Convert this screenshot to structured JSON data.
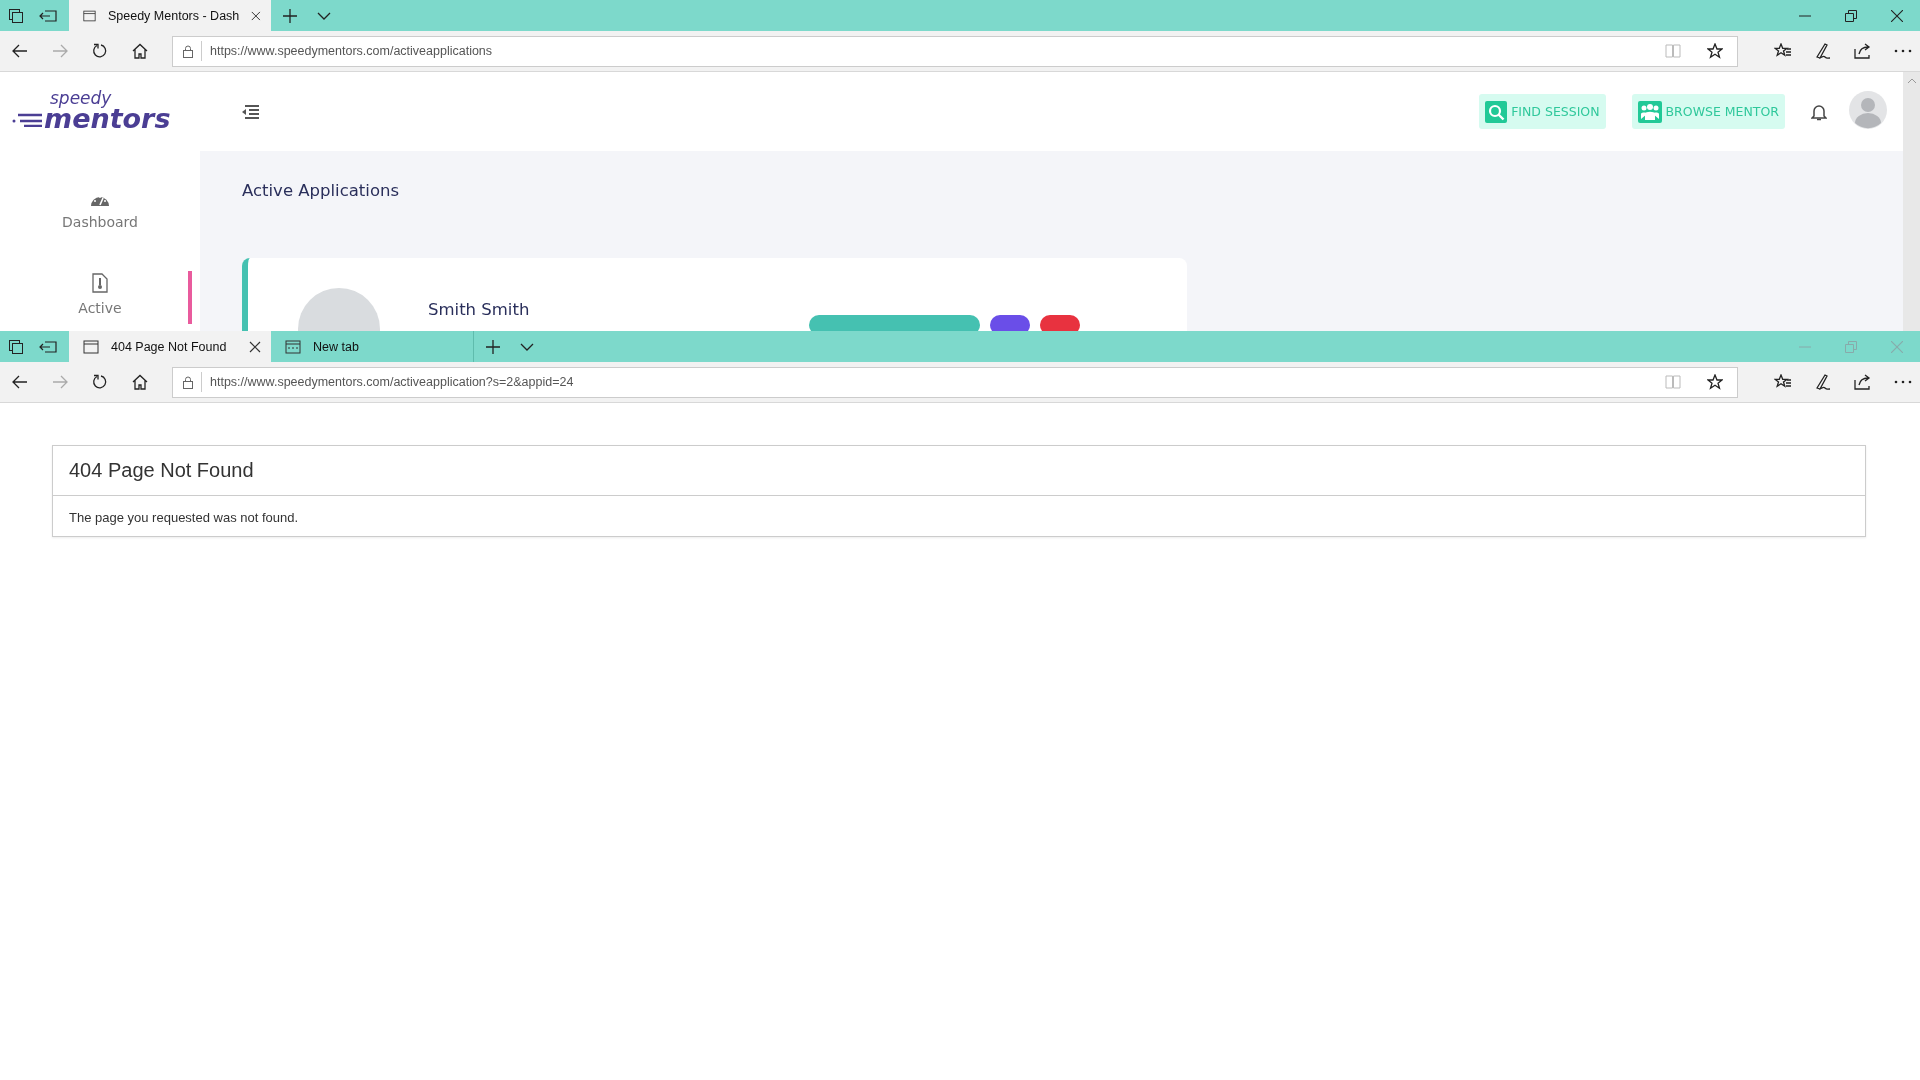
{
  "windows": [
    {
      "kind": "mentors",
      "active": true,
      "tabs": [
        {
          "title": "Speedy Mentors - Dash",
          "kind": "page",
          "selected": true
        }
      ],
      "url": "https://www.speedymentors.com/activeapplications",
      "page": {
        "logo": {
          "top": "speedy",
          "bottom": "mentors"
        },
        "header_buttons": [
          {
            "kind": "search",
            "label": "FIND SESSION"
          },
          {
            "kind": "group",
            "label": "BROWSE MENTOR"
          }
        ],
        "sidebar": {
          "items": [
            {
              "kind": "dashboard",
              "label": "Dashboard",
              "selected": false
            },
            {
              "kind": "file",
              "label": "Active",
              "selected": true
            }
          ]
        },
        "title": "Active Applications",
        "applications": [
          {
            "name": "Smith Smith",
            "actions": [
              {
                "color": "#45c1b1"
              },
              {
                "color": "#6a4ee8"
              },
              {
                "color": "#e8323f"
              }
            ]
          }
        ]
      }
    },
    {
      "kind": "not_found",
      "active": false,
      "tabs": [
        {
          "title": "404 Page Not Found",
          "kind": "page",
          "selected": true
        },
        {
          "title": "New tab",
          "kind": "newtab",
          "selected": false
        }
      ],
      "url": "https://www.speedymentors.com/activeapplication?s=2&appid=24",
      "page": {
        "heading": "404 Page Not Found",
        "message": "The page you requested was not found."
      }
    }
  ]
}
